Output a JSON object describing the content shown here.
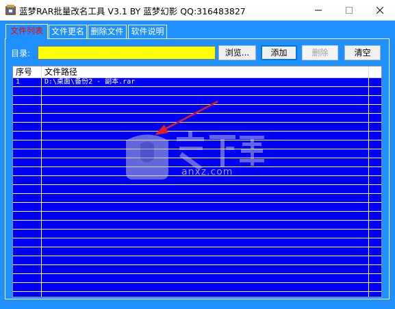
{
  "window": {
    "title": "蓝梦RAR批量改名工具 V3.1 BY 蓝梦幻影 QQ:316483827",
    "minimize_icon": "minimize-icon",
    "maximize_icon": "maximize-icon",
    "close_icon": "close-icon"
  },
  "tabs": [
    {
      "label": "文件列表",
      "active": true
    },
    {
      "label": "文件更名",
      "active": false
    },
    {
      "label": "删除文件",
      "active": false
    },
    {
      "label": "软件说明",
      "active": false
    }
  ],
  "directory": {
    "label": "目录:",
    "value": ""
  },
  "buttons": {
    "browse": "浏览...",
    "add": "添加",
    "delete": "删除",
    "clear": "清空"
  },
  "list": {
    "columns": [
      "序号",
      "文件路径"
    ],
    "rows": [
      {
        "index": "1",
        "path": "D:\\桌面\\备份2 - 副本.rar"
      }
    ]
  },
  "watermark": {
    "text": "anxz.com"
  },
  "colors": {
    "background": "#1E90FF",
    "list_background": "#0000F5",
    "directory_input": "#FFFF00",
    "active_tab_text": "#FF0000",
    "annotation_arrow": "#E02020"
  }
}
